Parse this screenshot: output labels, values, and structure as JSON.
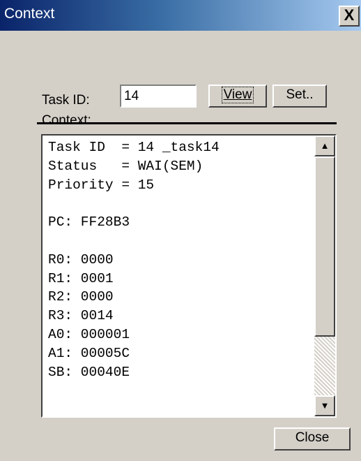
{
  "window": {
    "title": "Context",
    "close_glyph": "X",
    "accent_color": "#0a246a"
  },
  "task": {
    "id_label": "Task ID:",
    "id_value": "14",
    "view_label": "View",
    "set_label": "Set.."
  },
  "context": {
    "label": "Context:",
    "lines": [
      "Task ID  = 14 _task14",
      "Status   = WAI(SEM)",
      "Priority = 15",
      "",
      "PC: FF28B3",
      "",
      "R0: 0000",
      "R1: 0001",
      "R2: 0000",
      "R3: 0014",
      "A0: 000001",
      "A1: 00005C",
      "SB: 00040E"
    ],
    "scroll_position": 0,
    "icons": {
      "up": "scroll-up-arrow",
      "down": "scroll-down-arrow"
    }
  },
  "footer": {
    "close_label": "Close"
  }
}
